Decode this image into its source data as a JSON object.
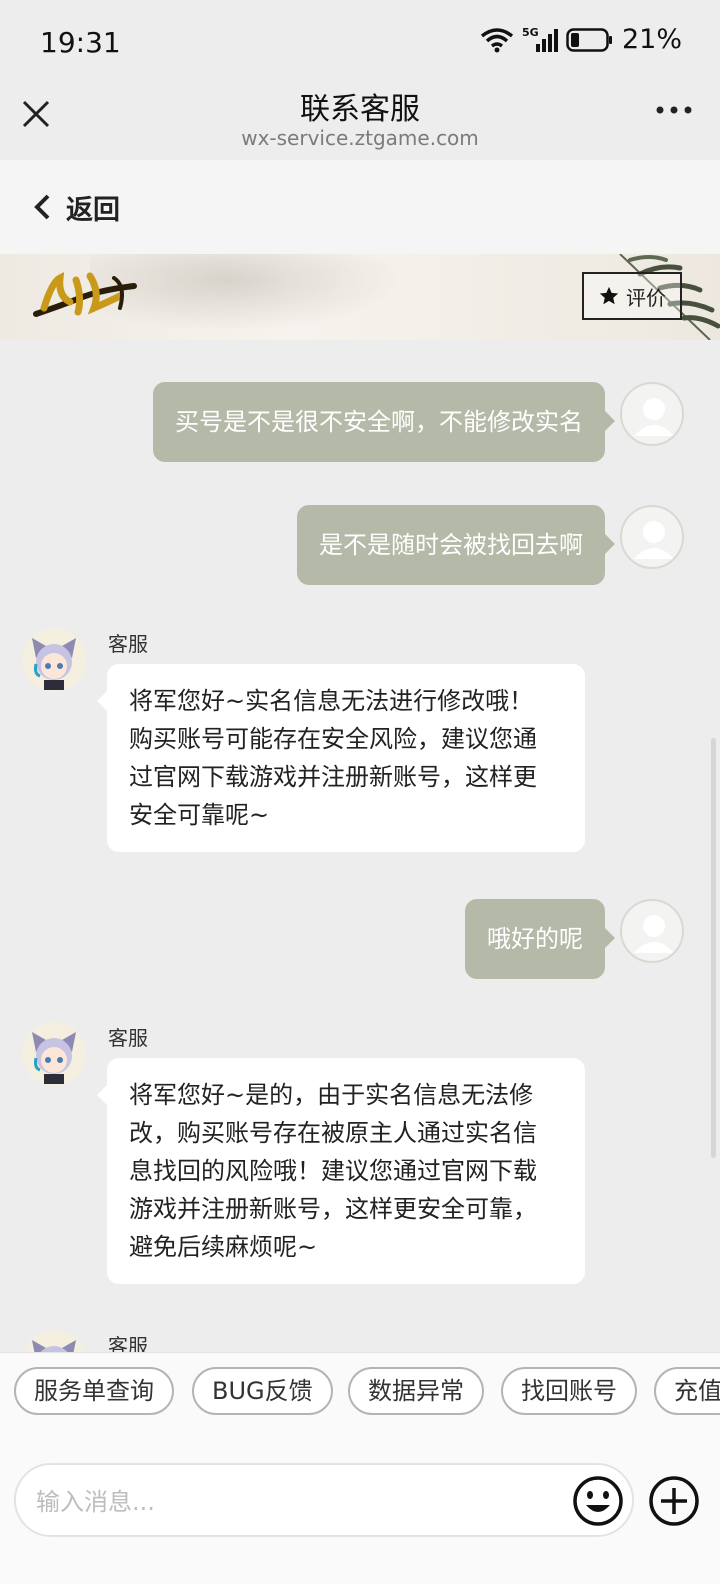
{
  "status_bar": {
    "time": "19:31",
    "network": "5G",
    "battery": "21%"
  },
  "header": {
    "title": "联系客服",
    "subtitle": "wx-service.ztgame.com"
  },
  "nav": {
    "back_label": "返回"
  },
  "banner": {
    "rate_label": "评价",
    "logo_text": "名将杀"
  },
  "messages": [
    {
      "from": "user",
      "text": "买号是不是很不安全啊，不能修改实名"
    },
    {
      "from": "user",
      "text": "是不是随时会被找回去啊"
    },
    {
      "from": "agent",
      "sender": "客服",
      "lines": [
        "将军您好~实名信息无法进行修改哦！",
        "购买账号可能存在安全风险，建议您通",
        "过官网下载游戏并注册新账号，这样更",
        "安全可靠呢~"
      ]
    },
    {
      "from": "user",
      "text": "哦好的呢"
    },
    {
      "from": "agent",
      "sender": "客服",
      "lines": [
        "将军您好~是的，由于实名信息无法修",
        "改，购买账号存在被原主人通过实名信",
        "息找回的风险哦！建议您通过官网下载",
        "游戏并注册新账号，这样更安全可靠，",
        "避免后续麻烦呢~"
      ]
    },
    {
      "from": "agent",
      "sender": "客服"
    }
  ],
  "quick_replies": [
    "服务单查询",
    "BUG反馈",
    "数据异常",
    "找回账号",
    "充值"
  ],
  "composer": {
    "placeholder": "输入消息..."
  },
  "colors": {
    "outgoing_bubble": "#b4b9a8",
    "background": "#ededed"
  }
}
